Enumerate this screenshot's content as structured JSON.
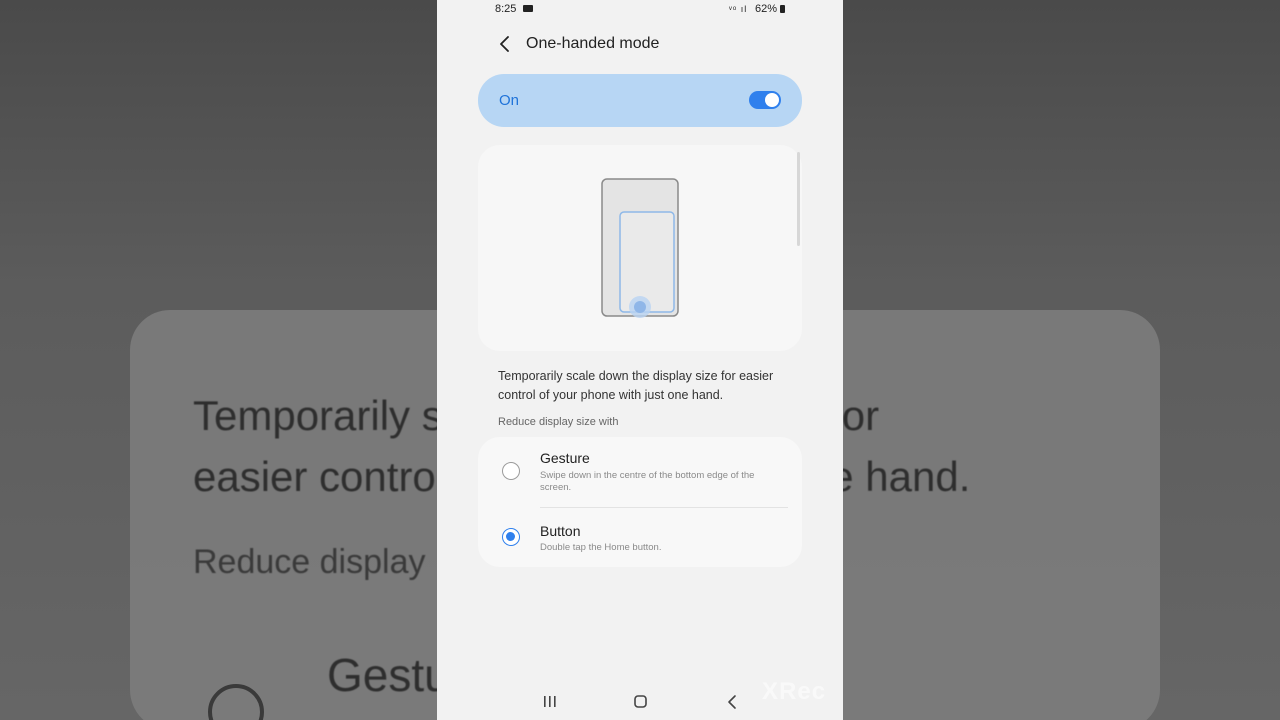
{
  "background": {
    "text_line_1": "Temporarily s                       y size for",
    "text_line_2": "easier contro                        ust one hand.",
    "text_line_3": "Reduce display",
    "text_line_4": "Gestu"
  },
  "status_bar": {
    "time": "8:25",
    "signal": "ᵛᵒ ıl",
    "battery": "62%"
  },
  "header": {
    "title": "One-handed mode"
  },
  "master_switch": {
    "label": "On",
    "state": "on"
  },
  "description": "Temporarily scale down the display size for easier control of your phone with just one hand.",
  "section_label": "Reduce display size with",
  "options": [
    {
      "title": "Gesture",
      "subtitle": "Swipe down in the centre of the bottom edge of the screen.",
      "selected": false
    },
    {
      "title": "Button",
      "subtitle": "Double tap the Home button.",
      "selected": true
    }
  ],
  "nav_bar": {
    "icons": [
      "recents-icon",
      "home-icon",
      "back-icon"
    ]
  },
  "watermark": "XRec",
  "colors": {
    "accent": "#2f80ed",
    "switch_bg": "#b7d6f4",
    "screen_bg": "#f2f2f2"
  }
}
